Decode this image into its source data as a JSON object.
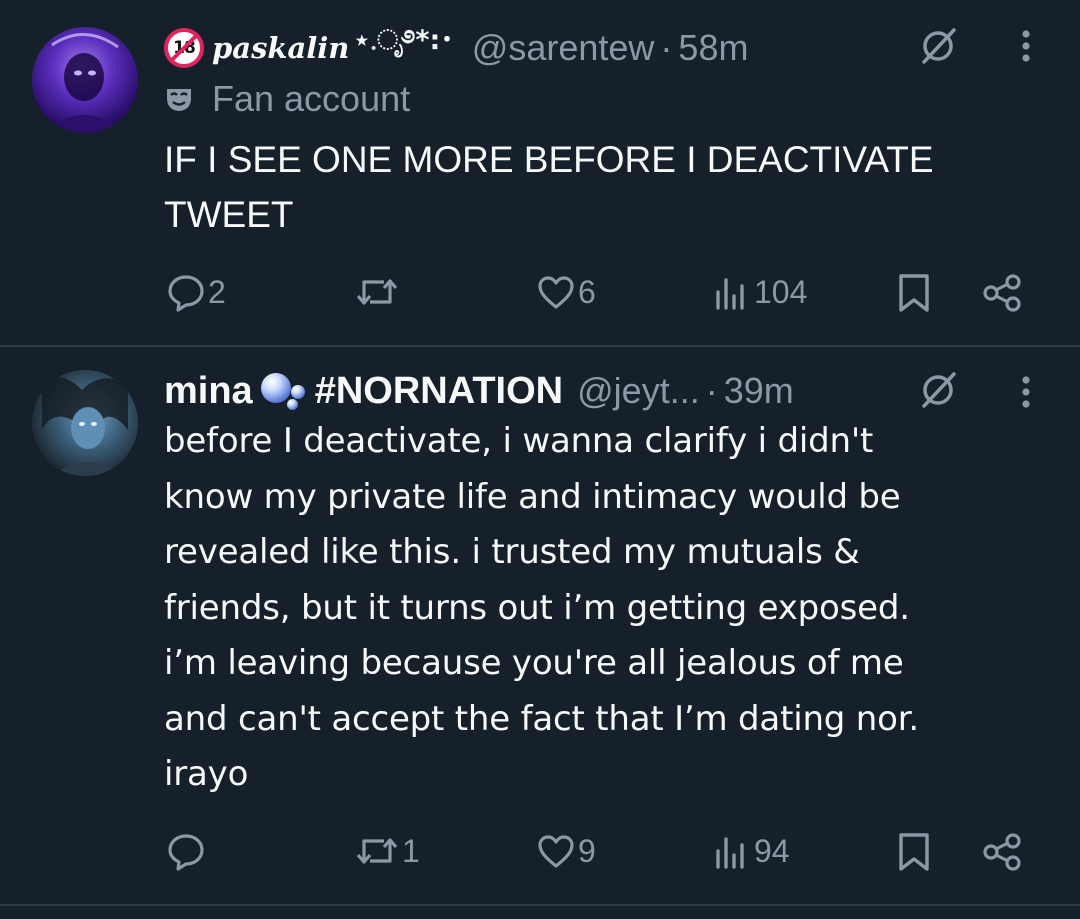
{
  "tweets": [
    {
      "badge": "18",
      "display_name": "paskalin",
      "name_decoration": "⋆.ೃ࿔*:･",
      "handle": "@sarentew",
      "separator": "·",
      "time": "58m",
      "label": "Fan account",
      "text": "IF I SEE ONE MORE BEFORE I DEACTIVATE TWEET",
      "actions": {
        "reply_count": "2",
        "retweet_count": "",
        "like_count": "6",
        "views_count": "104"
      }
    },
    {
      "display_name": "mina",
      "hashtag_name": "#NORNATION",
      "handle": "@jeyt...",
      "separator": "·",
      "time": "39m",
      "text": "before I deactivate, i wanna clarify i didn't\nknow my private life and intimacy would be\nrevealed like this. i trusted my mutuals &\nfriends, but it turns out i’m getting exposed.\ni’m leaving because you're all jealous of me\nand can't accept the fact that I’m dating nor.\nirayo",
      "actions": {
        "reply_count": "",
        "retweet_count": "1",
        "like_count": "9",
        "views_count": "94"
      }
    }
  ],
  "icons": {
    "age_restricted": "18-plus-badge",
    "label": "mask-icon",
    "grok": "grok-icon",
    "more": "more-vertical-icon",
    "reply": "reply-icon",
    "retweet": "retweet-icon",
    "like": "heart-icon",
    "views": "views-icon",
    "bookmark": "bookmark-icon",
    "share": "share-icon"
  },
  "colors": {
    "background": "#15202b",
    "text": "#f7f9f9",
    "secondary": "#8b98a5",
    "divider": "#2f3942",
    "badge_red": "#e0245e"
  }
}
